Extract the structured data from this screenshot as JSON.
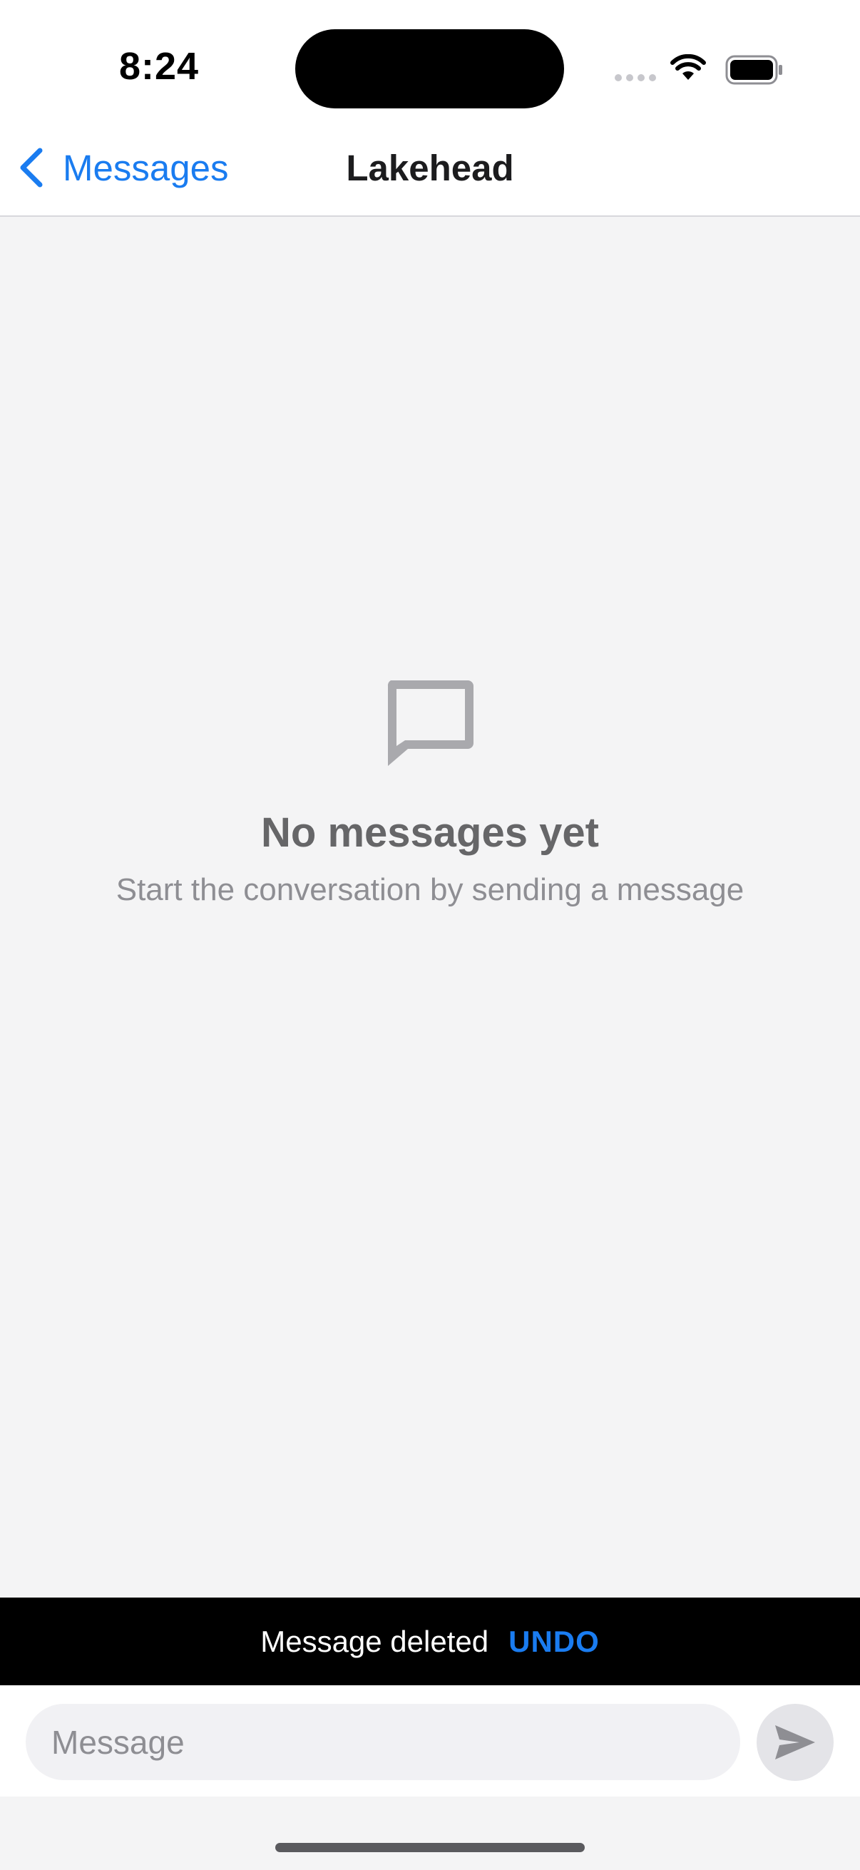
{
  "status_bar": {
    "time": "8:24",
    "icons": [
      "cellular-signal-icon",
      "wifi-icon",
      "battery-icon"
    ]
  },
  "nav": {
    "back_label": "Messages",
    "title": "Lakehead"
  },
  "empty_state": {
    "icon": "chat-bubble-icon",
    "title": "No messages yet",
    "subtitle": "Start the conversation by sending a message"
  },
  "snackbar": {
    "text": "Message deleted",
    "action_label": "UNDO"
  },
  "composer": {
    "placeholder": "Message",
    "value": "",
    "send_icon": "send-icon"
  },
  "colors": {
    "accent": "#1a7cf0",
    "background": "#f4f4f5",
    "snackbar": "#000000"
  }
}
